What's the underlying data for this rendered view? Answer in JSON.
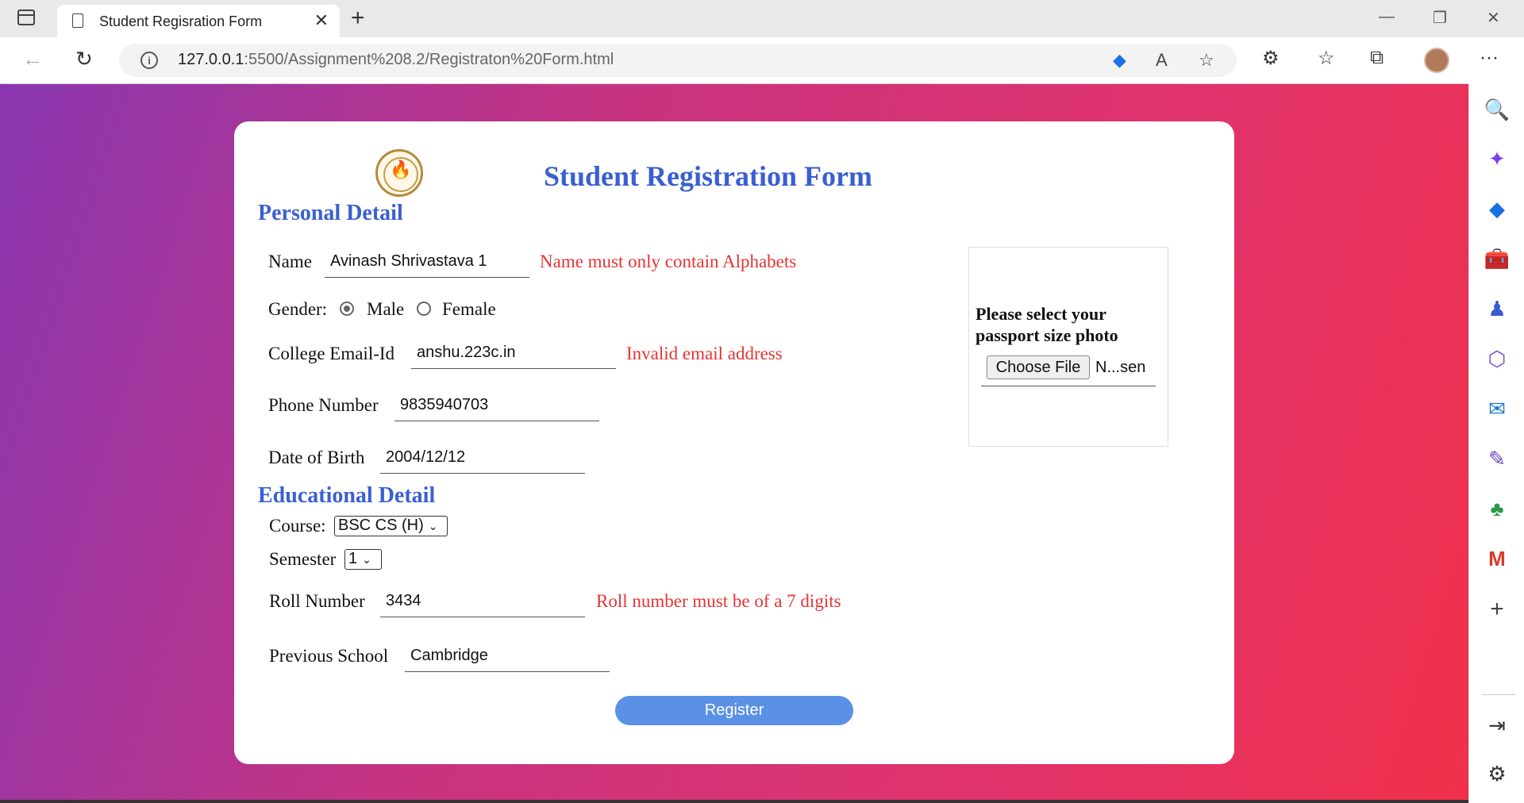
{
  "browser": {
    "tab_title": "Student Regisration Form",
    "tab_close": "✕",
    "new_tab": "+",
    "url_host": "127.0.0.1",
    "url_rest": ":5500/Assignment%208.2/Registraton%20Form.html",
    "window_controls": [
      "—",
      "❐",
      "✕"
    ],
    "nav": {
      "back": "←",
      "reload": "↻"
    },
    "more": "···"
  },
  "form": {
    "title": "Student Registration Form",
    "personal_section": "Personal Detail",
    "name_label": "Name",
    "name_value": "Avinash Shrivastava 1",
    "name_error": "Name must only contain Alphabets",
    "gender_label": "Gender:",
    "gender_options": [
      "Male",
      "Female"
    ],
    "gender_selected": "Male",
    "email_label": "College Email-Id",
    "email_value": "anshu.223c.in",
    "email_error": "Invalid email address",
    "phone_label": "Phone Number",
    "phone_value": "9835940703",
    "dob_label": "Date of Birth",
    "dob_value": "2004/12/12",
    "education_section": "Educational Detail",
    "course_label": "Course:",
    "course_value": "BSC CS (H)",
    "semester_label": "Semester",
    "semester_value": "1",
    "roll_label": "Roll Number",
    "roll_value": "3434",
    "roll_error": "Roll number must be of a 7 digits",
    "school_label": "Previous School",
    "school_value": "Cambridge",
    "photo_label_line1": "Please select your",
    "photo_label_line2": "passport size photo",
    "choose_file": "Choose File",
    "file_status": "N...sen",
    "register": "Register"
  },
  "colors": {
    "heading": "#3a5fd0",
    "error": "#e53434",
    "button": "#5a90e6",
    "gradient_start": "#8a37b0",
    "gradient_end": "#f0304a"
  }
}
